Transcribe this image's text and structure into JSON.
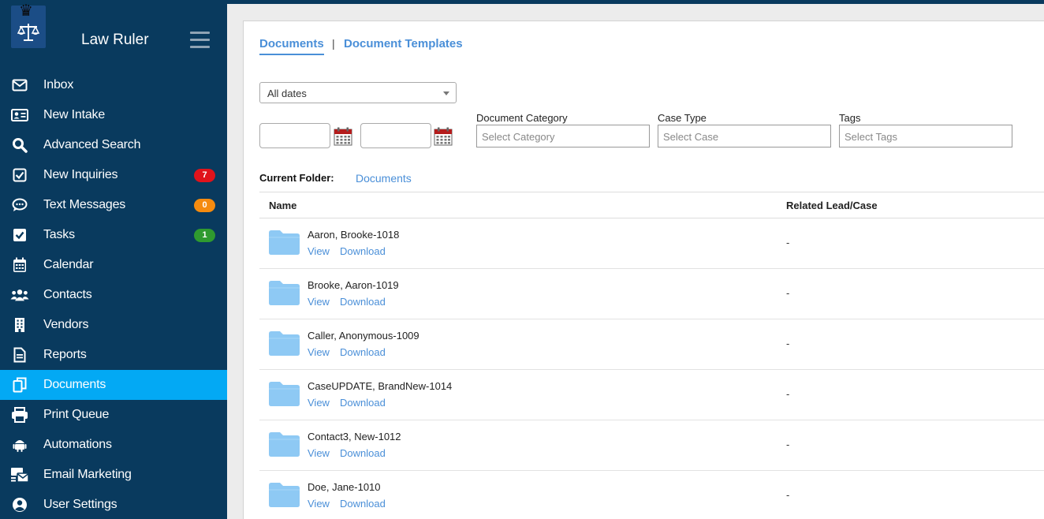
{
  "app": {
    "title": "Law Ruler"
  },
  "sidebar": {
    "items": [
      {
        "label": "Inbox",
        "icon": "envelope-icon"
      },
      {
        "label": "New Intake",
        "icon": "id-card-icon"
      },
      {
        "label": "Advanced Search",
        "icon": "search-icon"
      },
      {
        "label": "New Inquiries",
        "icon": "checkbox-icon",
        "badge": "7",
        "badge_color": "#e0131b"
      },
      {
        "label": "Text Messages",
        "icon": "chat-icon",
        "badge": "0",
        "badge_color": "#f58b0f"
      },
      {
        "label": "Tasks",
        "icon": "check-square-icon",
        "badge": "1",
        "badge_color": "#2f9a2f"
      },
      {
        "label": "Calendar",
        "icon": "calendar-icon"
      },
      {
        "label": "Contacts",
        "icon": "users-icon"
      },
      {
        "label": "Vendors",
        "icon": "building-icon"
      },
      {
        "label": "Reports",
        "icon": "file-text-icon"
      },
      {
        "label": "Documents",
        "icon": "copy-icon",
        "active": true
      },
      {
        "label": "Print Queue",
        "icon": "printer-icon"
      },
      {
        "label": "Automations",
        "icon": "android-icon"
      },
      {
        "label": "Email Marketing",
        "icon": "mail-bulk-icon"
      },
      {
        "label": "User Settings",
        "icon": "user-circle-icon"
      }
    ]
  },
  "tabs": [
    {
      "label": "Documents",
      "active": true
    },
    {
      "label": "Document Templates",
      "active": false
    }
  ],
  "tab_separator": "|",
  "filters": {
    "dates": {
      "selected": "All dates"
    },
    "category": {
      "label": "Document Category",
      "placeholder": "Select Category"
    },
    "case_type": {
      "label": "Case Type",
      "placeholder": "Select Case"
    },
    "tags": {
      "label": "Tags",
      "placeholder": "Select Tags"
    }
  },
  "current_folder": {
    "label": "Current Folder:",
    "value": "Documents"
  },
  "table": {
    "columns": [
      "Name",
      "Related Lead/Case"
    ],
    "action_view": "View",
    "action_download": "Download",
    "rows": [
      {
        "name": "Aaron, Brooke-1018",
        "related": "-"
      },
      {
        "name": "Brooke, Aaron-1019",
        "related": "-"
      },
      {
        "name": "Caller, Anonymous-1009",
        "related": "-"
      },
      {
        "name": "CaseUPDATE, BrandNew-1014",
        "related": "-"
      },
      {
        "name": "Contact3, New-1012",
        "related": "-"
      },
      {
        "name": "Doe, Jane-1010",
        "related": "-"
      }
    ]
  },
  "colors": {
    "sidebar_bg": "#093a5e",
    "active_item": "#03a9f4",
    "link": "#4a8fd8",
    "folder": "#8ec9f4"
  }
}
